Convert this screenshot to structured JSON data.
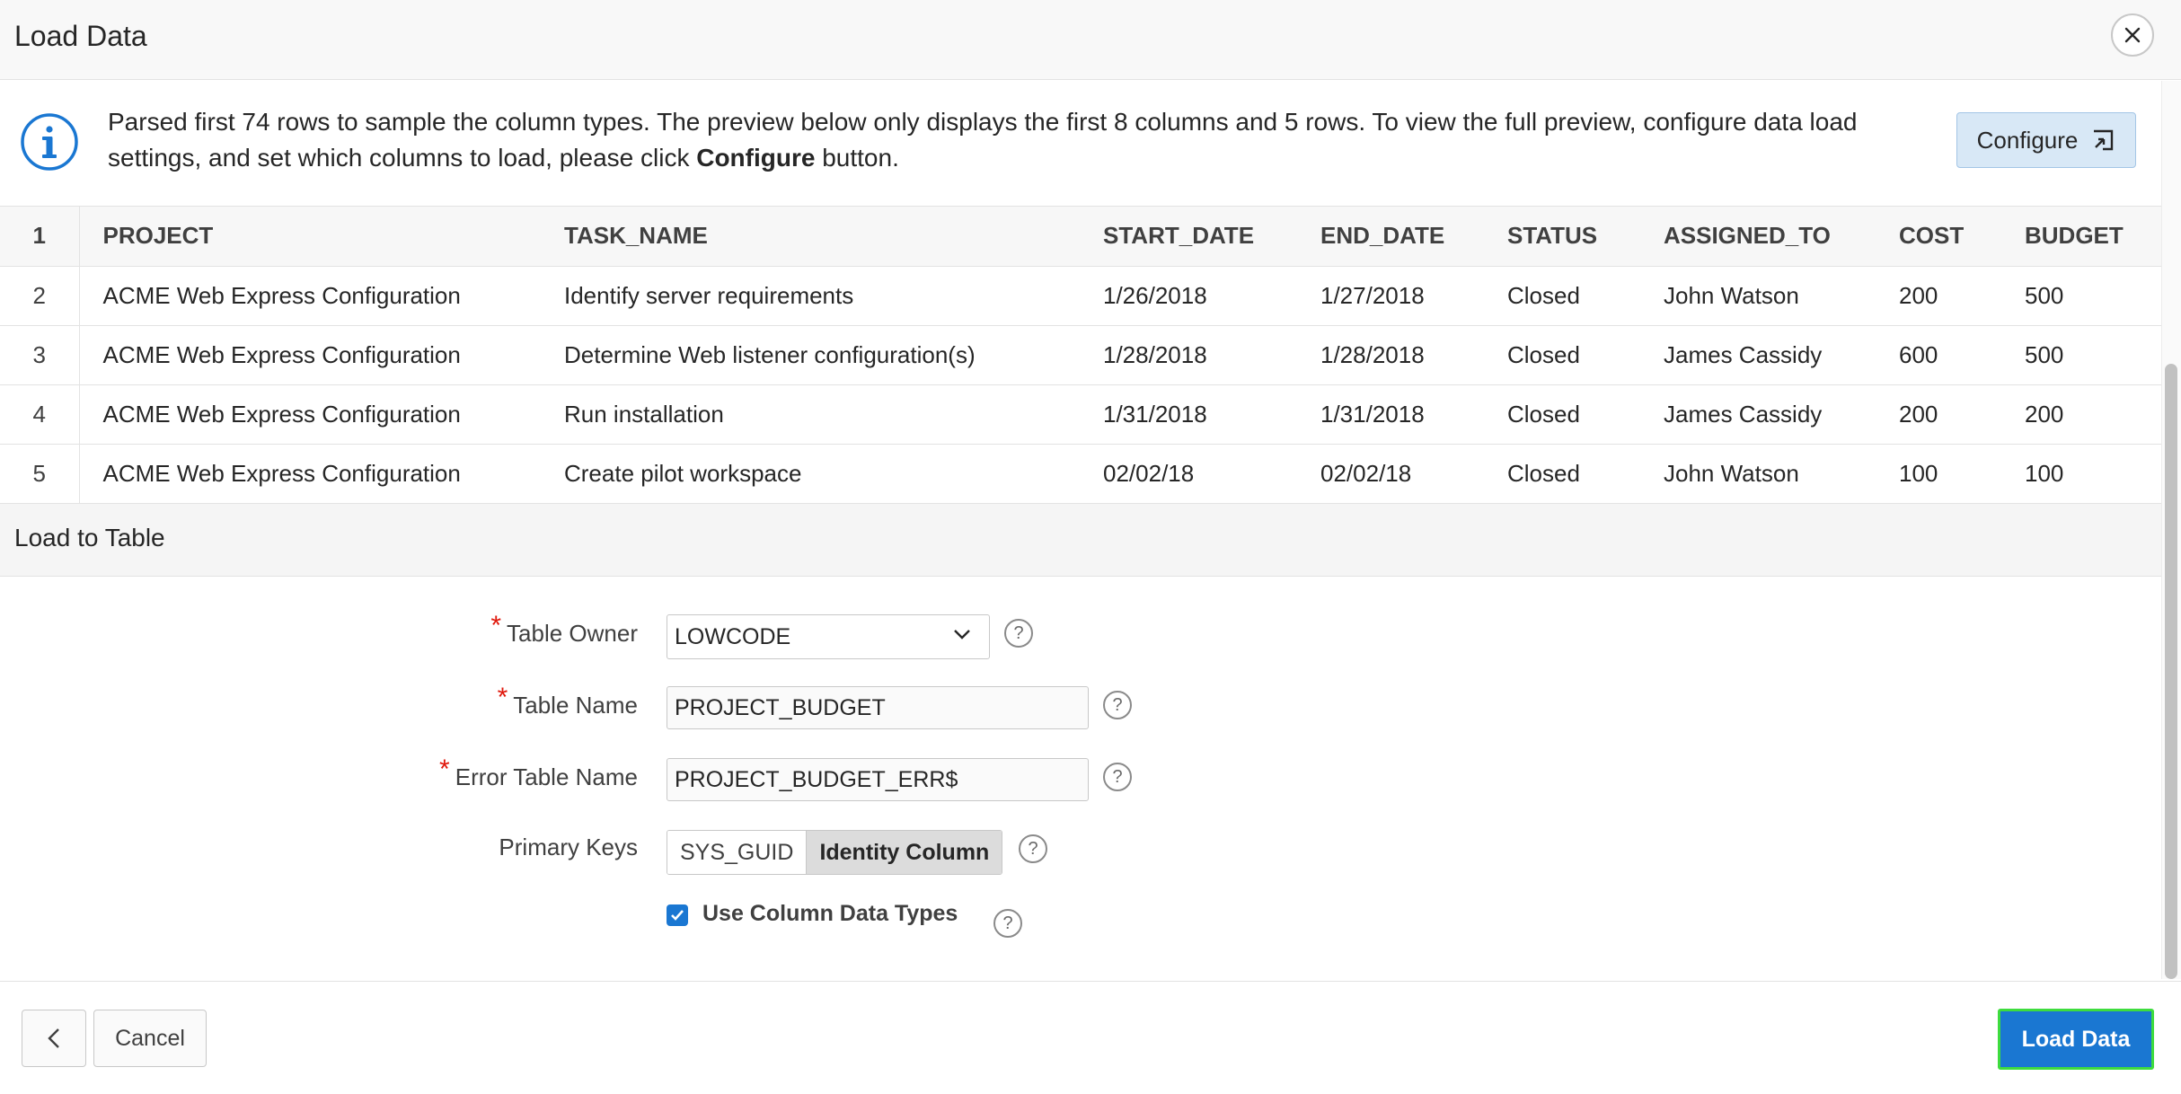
{
  "dialog": {
    "title": "Load Data"
  },
  "info": {
    "text_before": "Parsed first 74 rows to sample the column types. The preview below only displays the first 8 columns and 5 rows. To view the full preview, configure data load settings, and set which columns to load, please click ",
    "text_bold": "Configure",
    "text_after": " button.",
    "configure_label": "Configure"
  },
  "preview": {
    "header_num": "1",
    "columns": [
      "PROJECT",
      "TASK_NAME",
      "START_DATE",
      "END_DATE",
      "STATUS",
      "ASSIGNED_TO",
      "COST",
      "BUDGET"
    ],
    "rows": [
      {
        "num": "2",
        "cells": [
          "ACME Web Express Configuration",
          "Identify server requirements",
          "1/26/2018",
          "1/27/2018",
          "Closed",
          "John Watson",
          "200",
          "500"
        ]
      },
      {
        "num": "3",
        "cells": [
          "ACME Web Express Configuration",
          "Determine Web listener configuration(s)",
          "1/28/2018",
          "1/28/2018",
          "Closed",
          "James Cassidy",
          "600",
          "500"
        ]
      },
      {
        "num": "4",
        "cells": [
          "ACME Web Express Configuration",
          "Run installation",
          "1/31/2018",
          "1/31/2018",
          "Closed",
          "James Cassidy",
          "200",
          "200"
        ]
      },
      {
        "num": "5",
        "cells": [
          "ACME Web Express Configuration",
          "Create pilot workspace",
          "02/02/18",
          "02/02/18",
          "Closed",
          "John Watson",
          "100",
          "100"
        ]
      }
    ]
  },
  "section": {
    "title": "Load to Table"
  },
  "form": {
    "table_owner": {
      "label": "Table Owner",
      "value": "LOWCODE"
    },
    "table_name": {
      "label": "Table Name",
      "value": "PROJECT_BUDGET"
    },
    "error_table_name": {
      "label": "Error Table Name",
      "value": "PROJECT_BUDGET_ERR$"
    },
    "primary_keys": {
      "label": "Primary Keys",
      "options": [
        "SYS_GUID",
        "Identity Column"
      ],
      "selected": "Identity Column"
    },
    "use_column_data_types": {
      "label": "Use Column Data Types",
      "checked": true
    },
    "help_glyph": "?"
  },
  "footer": {
    "cancel_label": "Cancel",
    "load_label": "Load Data"
  },
  "colors": {
    "primary": "#1a77d2",
    "required": "#e0180c",
    "focus_outline": "#3edc3e",
    "info_icon": "#1a77d2"
  }
}
